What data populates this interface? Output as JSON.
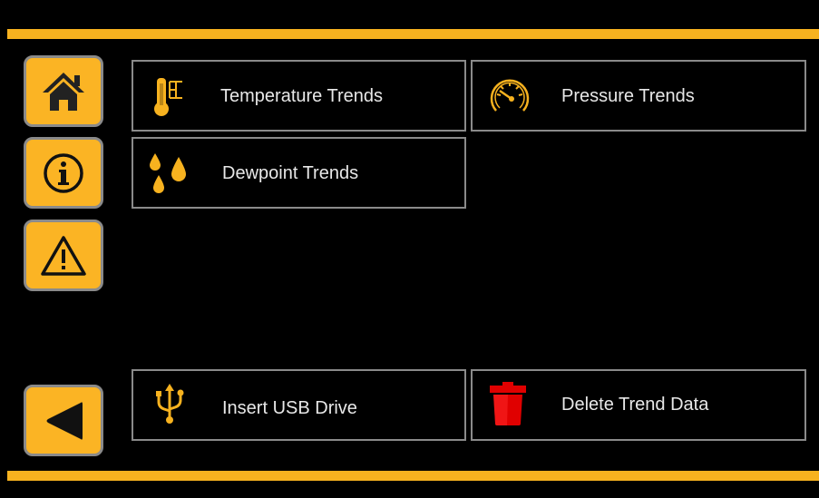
{
  "colors": {
    "accent": "#f7b21f",
    "button_fill": "#fbb424",
    "border": "#8a8a8a",
    "delete_red": "#e00000",
    "background": "#000000"
  },
  "sidebar": {
    "items": [
      {
        "name": "home",
        "icon": "home-icon"
      },
      {
        "name": "info",
        "icon": "info-icon"
      },
      {
        "name": "warning",
        "icon": "warning-icon"
      },
      {
        "name": "back",
        "icon": "back-arrow-icon"
      }
    ]
  },
  "tiles": {
    "temperature": {
      "label": "Temperature Trends",
      "icon": "thermometer-icon"
    },
    "pressure": {
      "label": "Pressure Trends",
      "icon": "gauge-icon"
    },
    "dewpoint": {
      "label": "Dewpoint Trends",
      "icon": "droplets-icon"
    },
    "usb": {
      "label": "Insert USB Drive",
      "icon": "usb-icon"
    },
    "delete": {
      "label": "Delete Trend Data",
      "icon": "trash-icon"
    }
  }
}
